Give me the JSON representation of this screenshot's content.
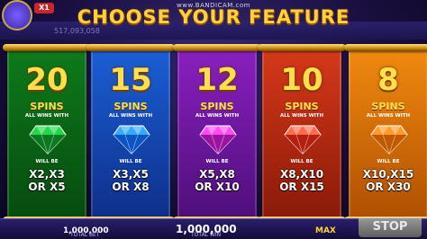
{
  "watermark": "www.BANDICAM.com",
  "title": "CHOOSE YOUR FEATURE",
  "top_bar": {
    "level_badge": "X1",
    "balance_partial": "517,093,058"
  },
  "features": [
    {
      "spins": "20",
      "spins_label": "SPINS",
      "all_wins": "ALL WINS WITH",
      "will_be": "WILL BE",
      "multiplier_line1": "X2,X3",
      "multiplier_line2": "OR X5",
      "color_top": "#0e7a1a",
      "color_bottom": "#064b10",
      "gem_color": "#22d94a",
      "gem_dark": "#0a7a22"
    },
    {
      "spins": "15",
      "spins_label": "SPINS",
      "all_wins": "ALL WINS WITH",
      "will_be": "WILL BE",
      "multiplier_line1": "X3,X5",
      "multiplier_line2": "OR X8",
      "color_top": "#1b5fd6",
      "color_bottom": "#0e2f8a",
      "gem_color": "#36a9ff",
      "gem_dark": "#0b55c4"
    },
    {
      "spins": "12",
      "spins_label": "SPINS",
      "all_wins": "ALL WINS WITH",
      "will_be": "WILL BE",
      "multiplier_line1": "X5,X8",
      "multiplier_line2": "OR X10",
      "color_top": "#8a1fc0",
      "color_bottom": "#4e0f7a",
      "gem_color": "#ff4cf0",
      "gem_dark": "#9a14a0"
    },
    {
      "spins": "10",
      "spins_label": "SPINS",
      "all_wins": "ALL WINS WITH",
      "will_be": "WILL BE",
      "multiplier_line1": "X8,X10",
      "multiplier_line2": "OR X15",
      "color_top": "#d6381a",
      "color_bottom": "#8a1a08",
      "gem_color": "#ff6a4a",
      "gem_dark": "#b42010"
    },
    {
      "spins": "8",
      "spins_label": "SPINS",
      "all_wins": "ALL WINS WITH",
      "will_be": "WILL BE",
      "multiplier_line1": "X10,X15",
      "multiplier_line2": "OR X30",
      "color_top": "#f08a10",
      "color_bottom": "#b04f00",
      "gem_color": "#ff9a2a",
      "gem_dark": "#c05a00"
    }
  ],
  "bottom_bar": {
    "total_bet_value": "1,000,000",
    "total_bet_label": "TOTAL BET",
    "total_win_value": "1,000,000",
    "total_win_label": "TOTAL WIN",
    "max_bet_label": "MAX",
    "stop_label": "STOP"
  }
}
